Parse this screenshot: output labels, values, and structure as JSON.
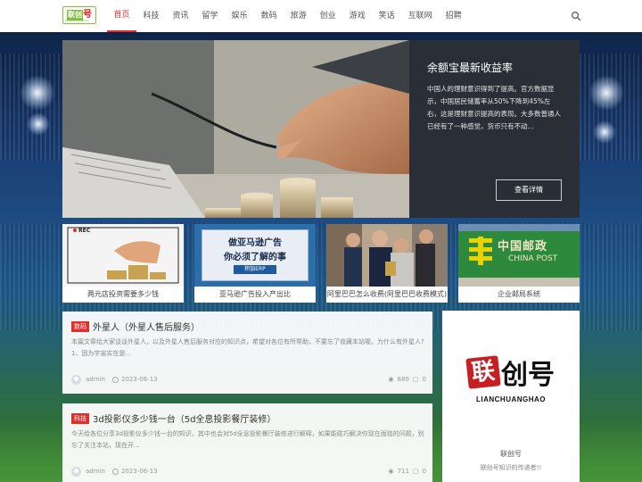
{
  "logo": {
    "mark_a": "联创",
    "mark_b": "号",
    "mark_sub": "LIANCHUANGHAO"
  },
  "nav": {
    "items": [
      "首页",
      "科技",
      "资讯",
      "留学",
      "娱乐",
      "数码",
      "旅游",
      "创业",
      "游戏",
      "笑话",
      "互联网",
      "招聘"
    ],
    "active_index": 0,
    "search_icon": "search-icon"
  },
  "hero": {
    "title": "余额宝最新收益率",
    "description": "中国人的理财意识得到了提高。官方数据显示，中国居民储蓄率从50%下降到45%左右，这是理财意识提高的表现。大多数普通人已经有了一种感觉，货币只有不动...",
    "button": "查看详情"
  },
  "thumbs": [
    {
      "caption": "两元店投资需要多少钱"
    },
    {
      "caption": "亚马逊广告投入产出比",
      "banner_line1": "做亚马逊广告",
      "banner_line2": "你必须了解的事",
      "banner_badge": "积加ERP"
    },
    {
      "caption": "阿里巴巴怎么收费(阿里巴巴收费模式)"
    },
    {
      "caption": "企业邮局系统",
      "sign_cn": "中国邮政",
      "sign_en": "CHINA POST"
    }
  ],
  "rec_label": "REC",
  "articles": [
    {
      "tag": "数码",
      "title": "外星人（外星人售后服务）",
      "excerpt": "本篇文章给大家谈谈外星人，以及外星人售后服务对应的知识点，希望对各位有所帮助，不要忘了收藏本站喔。为什么有外星人?1、因为宇宙实在是...",
      "author": "admin",
      "date": "2023-06-13",
      "views": "889",
      "comments": "0"
    },
    {
      "tag": "科技",
      "title": "3d投影仪多少钱一台（5d全息投影餐厅装修）",
      "excerpt": "今天给各位分享3d投影仪多少钱一台的知识，其中也会对5d全息投影餐厅装修进行解释，如果能碰巧解决你现在面临的问题，别忘了关注本站，现在开...",
      "author": "admin",
      "date": "2023-06-13",
      "views": "711",
      "comments": "0"
    }
  ],
  "sidebar": {
    "logo_lian": "联",
    "logo_chuanghao": "创号",
    "logo_pinyin": "LIANCHUANGHAO",
    "name": "联创号",
    "description": "联创号知识的传递者!!"
  },
  "colors": {
    "accent": "#e0302c",
    "hero_panel": "#2a2f37",
    "logo_green": "#7ec23a"
  }
}
